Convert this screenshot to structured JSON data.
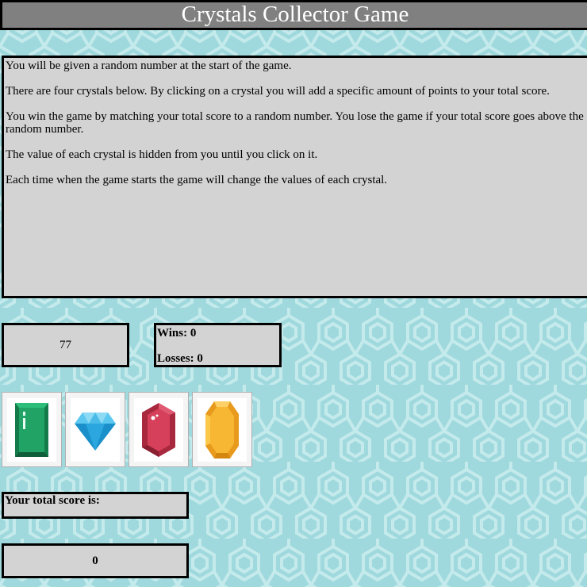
{
  "header": {
    "title": "Crystals Collector Game"
  },
  "instructions": {
    "paragraphs": [
      "You will be given a random number at the start of the game.",
      "There are four crystals below. By clicking on a crystal you will add a specific amount of points to your total score.",
      "You win the game by matching your total score to a random number. You lose the game if your total score goes above the random number.",
      "The value of each crystal is hidden from you until you click on it.",
      "Each time when the game starts the game will change the values of each crystal."
    ]
  },
  "target": {
    "value": "77"
  },
  "record": {
    "wins_label": "Wins:",
    "wins": "0",
    "losses_label": "Losses:",
    "losses": "0"
  },
  "crystals": [
    {
      "icon": "green-emerald-icon",
      "color": "#21a366"
    },
    {
      "icon": "blue-diamond-icon",
      "color": "#29a8e0"
    },
    {
      "icon": "red-ruby-icon",
      "color": "#d6405a"
    },
    {
      "icon": "yellow-topaz-icon",
      "color": "#f7b733"
    }
  ],
  "score": {
    "label": "Your total score is:",
    "value": "0"
  },
  "colors": {
    "background": "#9fd9dd",
    "panel": "#d3d3d3",
    "header": "#808080"
  }
}
